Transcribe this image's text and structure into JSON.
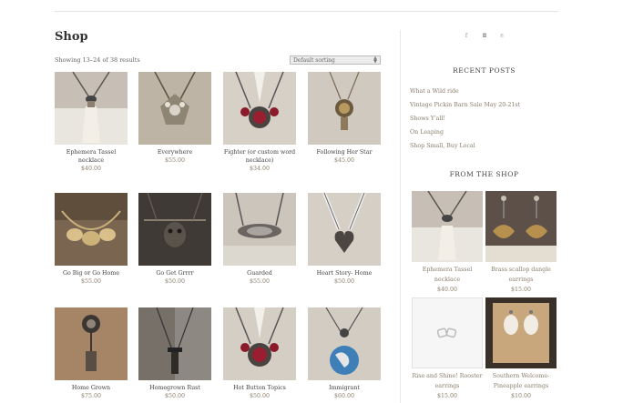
{
  "page": {
    "title": "Shop",
    "result_count": "Showing 13–24 of 38 results",
    "sort_selected": "Default sorting"
  },
  "products": [
    {
      "name": "Ephemera Tassel necklace",
      "price": "$40.00"
    },
    {
      "name": "Everywhere",
      "price": "$55.00"
    },
    {
      "name": "Fighter (or custom word necklace)",
      "price": "$34.00"
    },
    {
      "name": "Following Her Star",
      "price": "$45.00"
    },
    {
      "name": "Go Big or Go Home",
      "price": "$55.00"
    },
    {
      "name": "Go Get Grrrr",
      "price": "$50.00"
    },
    {
      "name": "Guarded",
      "price": "$55.00"
    },
    {
      "name": "Heart Story- Home",
      "price": "$50.00"
    },
    {
      "name": "Home Grown",
      "price": "$75.00"
    },
    {
      "name": "Homegrown Rust",
      "price": "$50.00"
    },
    {
      "name": "Hot Button Topics",
      "price": "$50.00"
    },
    {
      "name": "Immigrant",
      "price": "$60.00"
    }
  ],
  "sidebar": {
    "social_icons": [
      "facebook-icon",
      "instagram-icon",
      "pinterest-icon"
    ],
    "social_glyphs": [
      "f",
      "◘",
      "℗"
    ],
    "recent_heading": "RECENT POSTS",
    "recent_posts": [
      "What a Wild ride",
      "Vintage Pickin Barn Sale May 20-21st",
      "Shows Y'all!",
      "On Leaping",
      "Shop Small, Buy Local"
    ],
    "shop_heading": "FROM THE SHOP",
    "shop_items": [
      {
        "name": "Ephemera Tassel necklace",
        "price": "$40.00"
      },
      {
        "name": "Brass scallop dangle earrings",
        "price": "$15.00"
      },
      {
        "name": "Rise and Shine! Rooster earrings",
        "price": "$15.00"
      },
      {
        "name": "Southern Welcome- Pineapple earrings",
        "price": "$10.00"
      }
    ]
  }
}
